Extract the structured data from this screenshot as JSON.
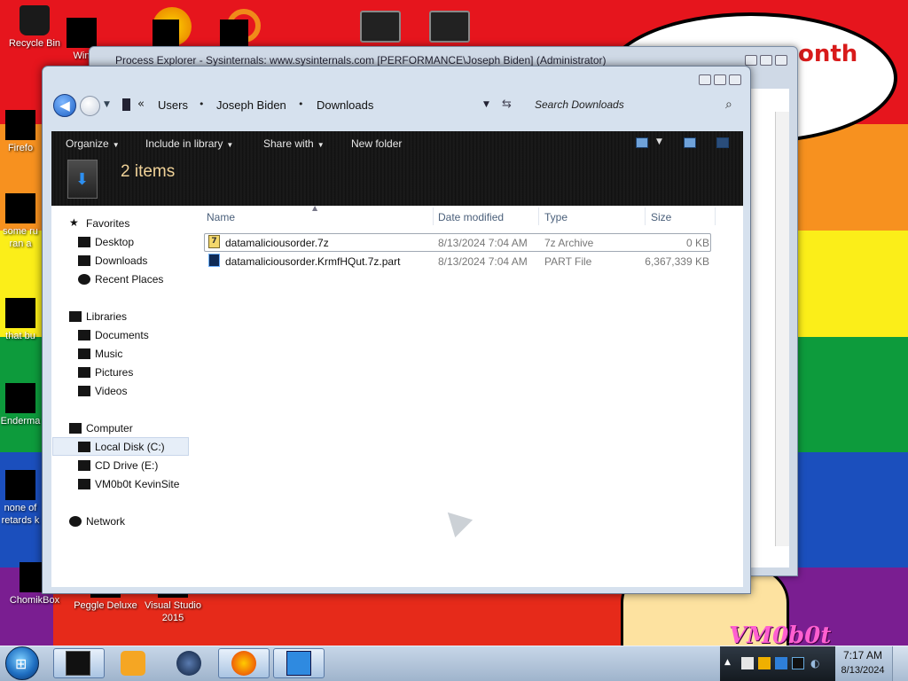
{
  "desktop": {
    "bubble_text": "onth",
    "watermark": "VM0b0t",
    "icons": [
      {
        "label": "Recycle Bin"
      },
      {
        "label": "Win"
      },
      {
        "label": "Firefo"
      },
      {
        "label": "some ru"
      },
      {
        "label": "ran a"
      },
      {
        "label": "that bu"
      },
      {
        "label": "Enderma"
      },
      {
        "label": "none of"
      },
      {
        "label": "retards k"
      },
      {
        "label": "ChomikBox"
      },
      {
        "label": "Peggle Deluxe"
      },
      {
        "label": "Visual Studio"
      },
      {
        "label": "2015"
      }
    ]
  },
  "process_explorer": {
    "title": "Process Explorer - Sysinternals: www.sysinternals.com [PERFORMANCE\\Joseph Biden] (Administrator)"
  },
  "explorer": {
    "breadcrumb": [
      "Users",
      "Joseph Biden",
      "Downloads"
    ],
    "search_placeholder": "Search Downloads",
    "toolbar": {
      "organize": "Organize",
      "include_in_library": "Include in library",
      "share_with": "Share with",
      "new_folder": "New folder"
    },
    "items_count": "2 items",
    "nav": {
      "favorites": "Favorites",
      "desktop": "Desktop",
      "downloads": "Downloads",
      "recent_places": "Recent Places",
      "libraries": "Libraries",
      "documents": "Documents",
      "music": "Music",
      "pictures": "Pictures",
      "videos": "Videos",
      "computer": "Computer",
      "local_disk": "Local Disk (C:)",
      "cd_drive": "CD Drive (E:)",
      "vm_site": "VM0b0t KevinSite",
      "network": "Network"
    },
    "columns": {
      "name": "Name",
      "date_modified": "Date modified",
      "type": "Type",
      "size": "Size"
    },
    "files": [
      {
        "name": "datamaliciousorder.7z",
        "date": "8/13/2024 7:04 AM",
        "type": "7z Archive",
        "size": "0 KB"
      },
      {
        "name": "datamaliciousorder.KrmfHQut.7z.part",
        "date": "8/13/2024 7:04 AM",
        "type": "PART File",
        "size": "6,367,339 KB"
      }
    ]
  },
  "taskbar": {
    "time": "7:17 AM",
    "date": "8/13/2024"
  }
}
